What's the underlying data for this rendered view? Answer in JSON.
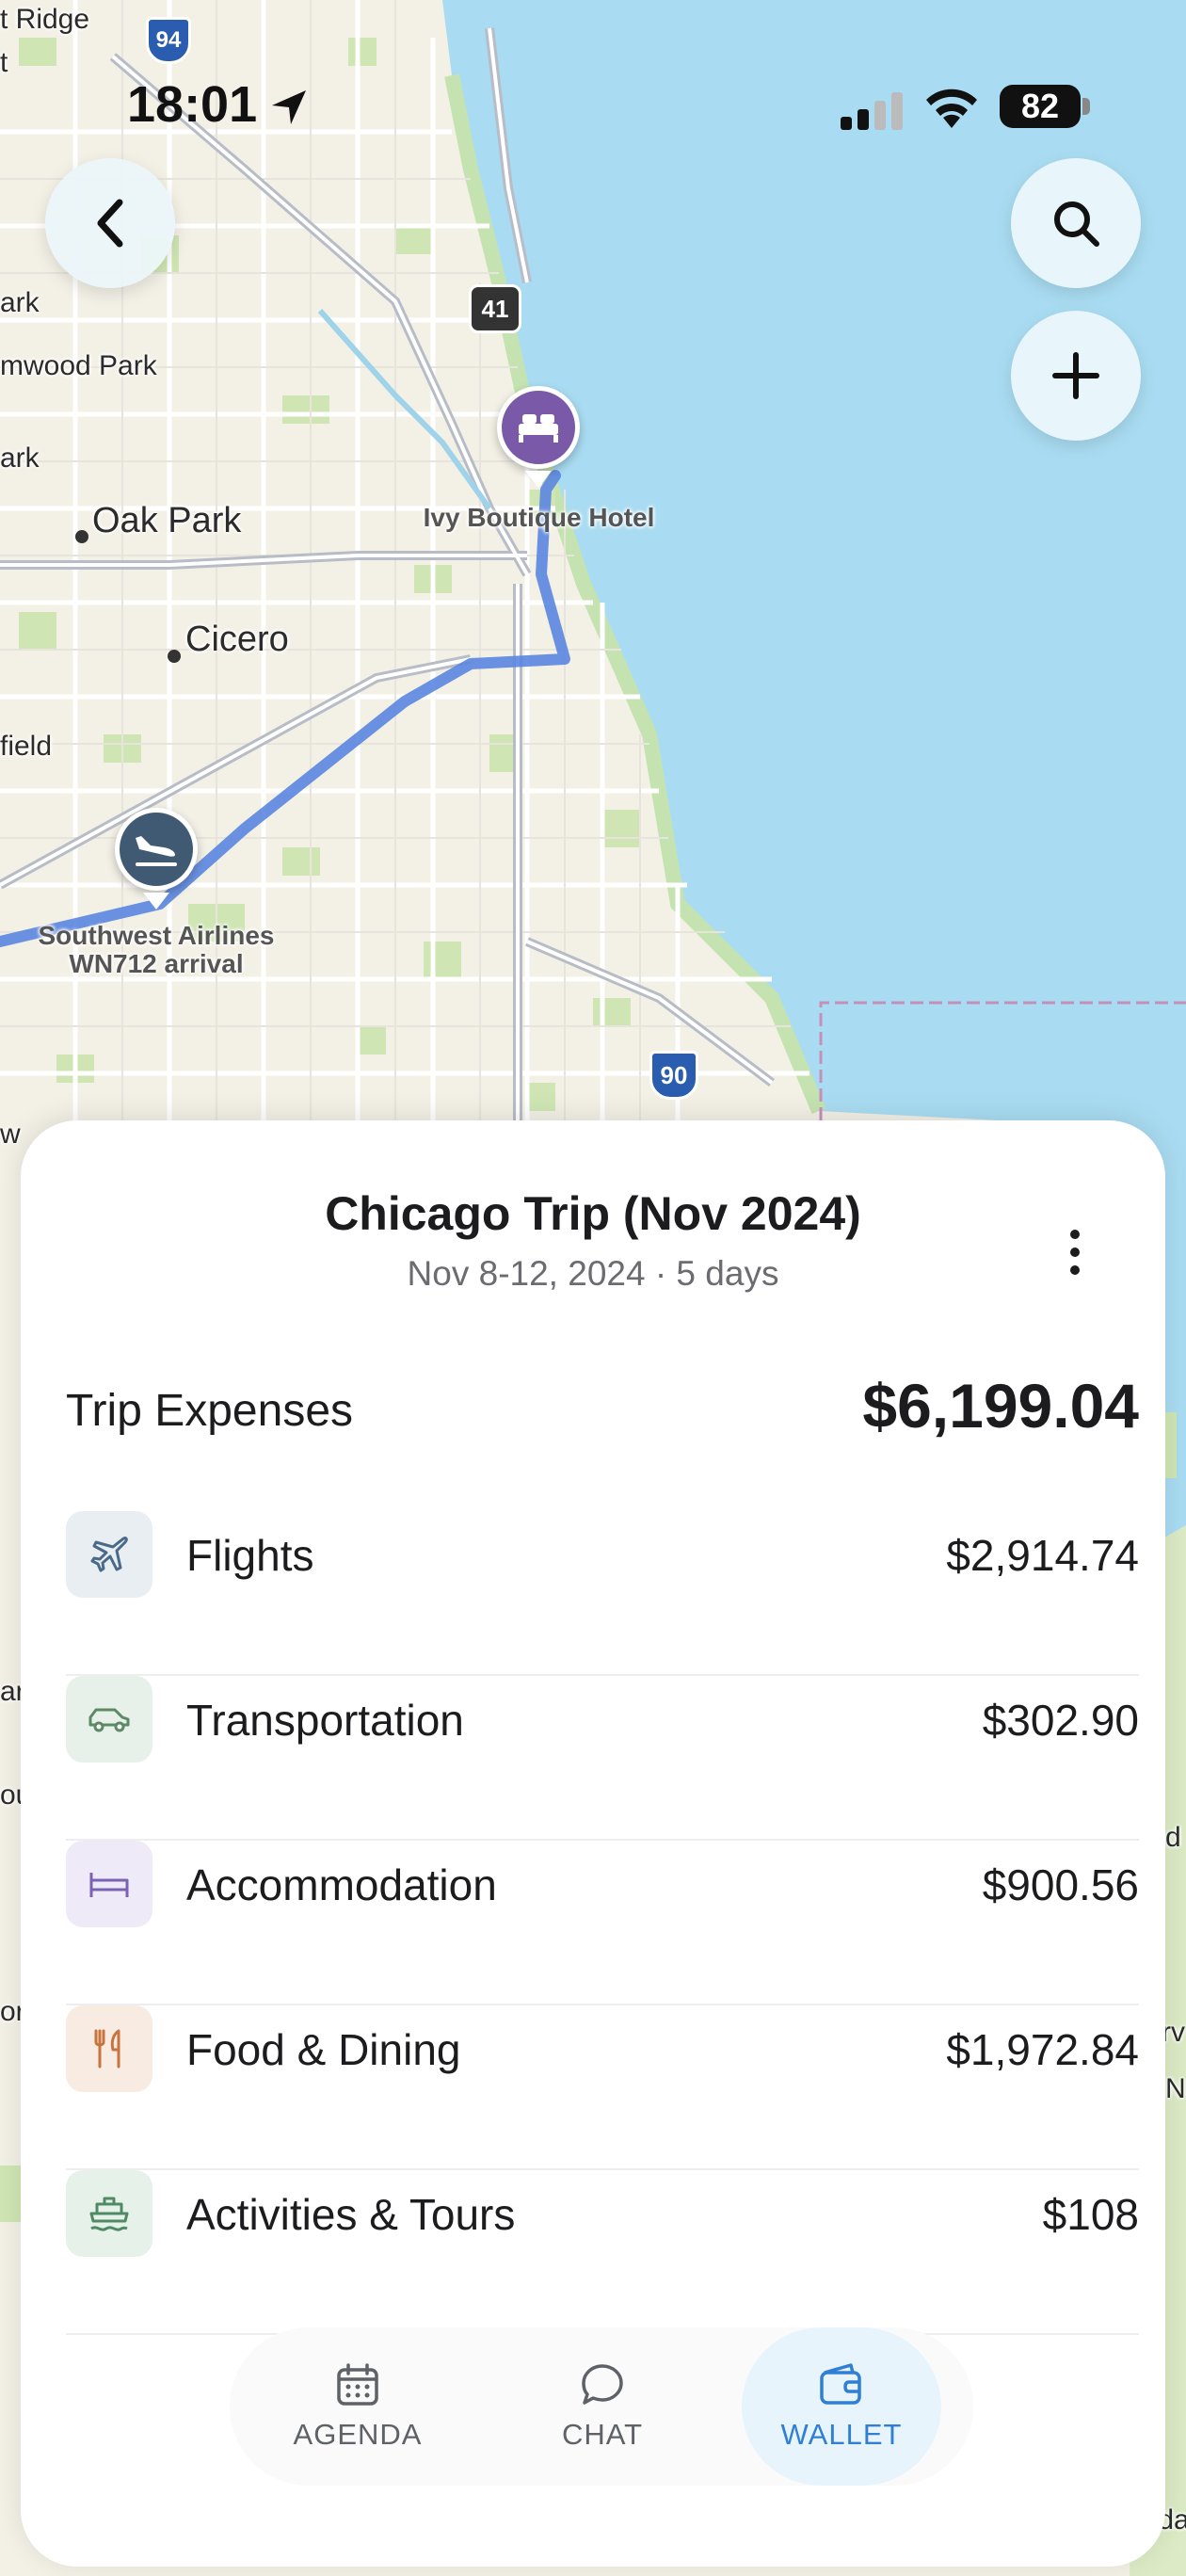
{
  "status_bar": {
    "time": "18:01",
    "battery": "82"
  },
  "map": {
    "labels": {
      "ridge": "t Ridge",
      "t": "t",
      "park_cut": "ark",
      "elmwood": "mwood Park",
      "ark2": "ark",
      "oak_park": "Oak Park",
      "cicero": "Cicero",
      "field": "field",
      "w": "w",
      "ar": "ar",
      "ou": "ou",
      "or": "or",
      "ceda": "Ceda",
      "d": "d",
      "n": "N",
      "rv": "rv"
    },
    "shields": {
      "i94": "94",
      "us41": "41",
      "i90": "90"
    },
    "pins": {
      "hotel": "Ivy Boutique Hotel",
      "flight_line1": "Southwest Airlines",
      "flight_line2": "WN712 arrival"
    }
  },
  "buttons": {
    "back": "back",
    "search": "search",
    "add": "add"
  },
  "trip": {
    "title": "Chicago Trip (Nov 2024)",
    "subtitle": "Nov 8-12, 2024 · 5 days"
  },
  "expenses": {
    "label": "Trip Expenses",
    "total": "$6,199.04",
    "items": [
      {
        "name": "Flights",
        "amount": "$2,914.74",
        "icon": "airplane-icon",
        "color": "#4a6a8a",
        "bg": "#e9eef3"
      },
      {
        "name": "Transportation",
        "amount": "$302.90",
        "icon": "car-icon",
        "color": "#5c8a66",
        "bg": "#e7f0e9"
      },
      {
        "name": "Accommodation",
        "amount": "$900.56",
        "icon": "bed-icon",
        "color": "#7b62b5",
        "bg": "#eeeaf7"
      },
      {
        "name": "Food & Dining",
        "amount": "$1,972.84",
        "icon": "fork-knife-icon",
        "color": "#c8743f",
        "bg": "#f8ebe2"
      },
      {
        "name": "Activities & Tours",
        "amount": "$108",
        "icon": "ship-icon",
        "color": "#4f8a64",
        "bg": "#e6f1e9"
      }
    ]
  },
  "tabs": {
    "agenda": "AGENDA",
    "chat": "CHAT",
    "wallet": "WALLET",
    "active": "wallet"
  },
  "colors": {
    "water": "#a9dcf2",
    "land": "#f3f1e6",
    "route": "#5b86e0",
    "accent": "#2f7fd4"
  }
}
